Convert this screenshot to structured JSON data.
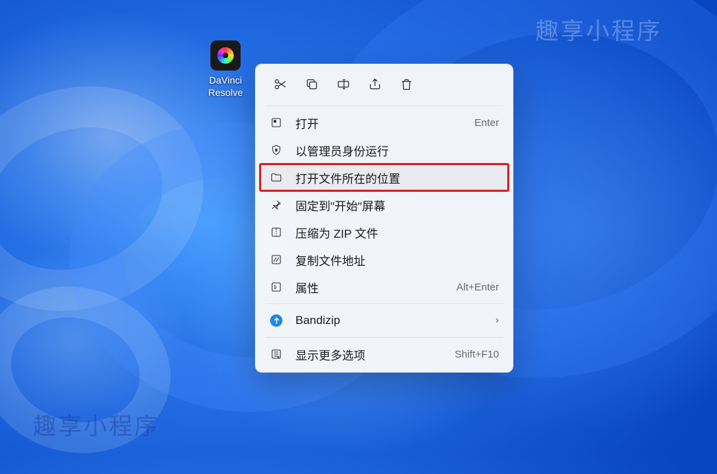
{
  "watermark_text": "趣享小程序",
  "desktop": {
    "icon_label": "DaVinci\nResolve"
  },
  "menu": {
    "quick": {
      "cut": "cut",
      "copy": "copy",
      "rename": "rename",
      "share": "share",
      "delete": "delete"
    },
    "items": [
      {
        "label": "打开",
        "shortcut": "Enter"
      },
      {
        "label": "以管理员身份运行",
        "shortcut": ""
      },
      {
        "label": "打开文件所在的位置",
        "shortcut": ""
      },
      {
        "label": "固定到\"开始\"屏幕",
        "shortcut": ""
      },
      {
        "label": "压缩为 ZIP 文件",
        "shortcut": ""
      },
      {
        "label": "复制文件地址",
        "shortcut": ""
      },
      {
        "label": "属性",
        "shortcut": "Alt+Enter"
      }
    ],
    "bandizip": {
      "label": "Bandizip"
    },
    "show_more": {
      "label": "显示更多选项",
      "shortcut": "Shift+F10"
    }
  }
}
